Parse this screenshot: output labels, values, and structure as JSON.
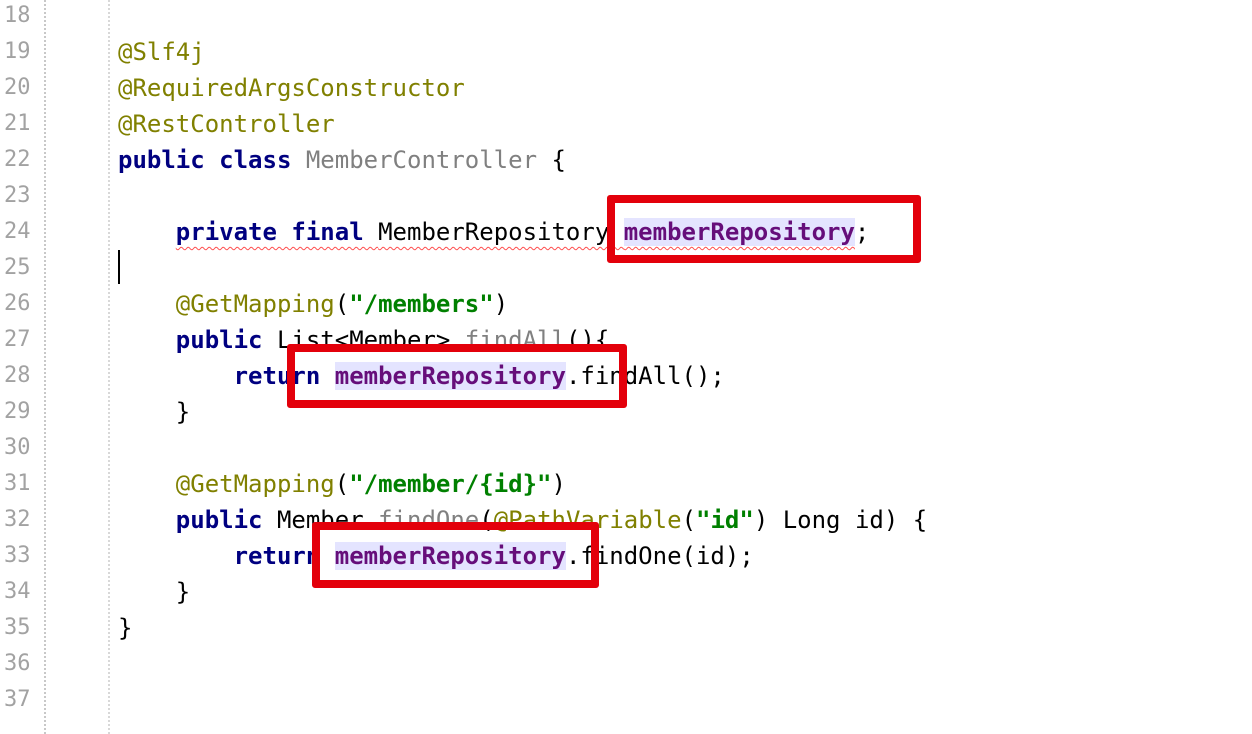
{
  "editor": {
    "lines": [
      {
        "num": "18",
        "segments": []
      },
      {
        "num": "19",
        "segments": [
          {
            "text": "@Slf4j",
            "style": "ann"
          }
        ]
      },
      {
        "num": "20",
        "segments": [
          {
            "text": "@RequiredArgsConstructor",
            "style": "ann"
          }
        ]
      },
      {
        "num": "21",
        "segments": [
          {
            "text": "@RestController",
            "style": "ann"
          }
        ]
      },
      {
        "num": "22",
        "segments": [
          {
            "text": "public class ",
            "style": "kw"
          },
          {
            "text": "MemberController",
            "style": "cls-gray"
          },
          {
            "text": " {",
            "style": ""
          }
        ]
      },
      {
        "num": "23",
        "segments": []
      },
      {
        "num": "24",
        "segments": [
          {
            "text": "    ",
            "style": ""
          },
          {
            "text": "private final ",
            "style": "kw warn"
          },
          {
            "text": "MemberRepository ",
            "style": "warn"
          },
          {
            "text": "memberRepository",
            "style": "fld warn"
          },
          {
            "text": ";",
            "style": ""
          }
        ]
      },
      {
        "num": "25",
        "segments": []
      },
      {
        "num": "26",
        "segments": [
          {
            "text": "    ",
            "style": ""
          },
          {
            "text": "@GetMapping",
            "style": "ann"
          },
          {
            "text": "(",
            "style": ""
          },
          {
            "text": "\"/members\"",
            "style": "str"
          },
          {
            "text": ")",
            "style": ""
          }
        ]
      },
      {
        "num": "27",
        "segments": [
          {
            "text": "    ",
            "style": ""
          },
          {
            "text": "public ",
            "style": "kw"
          },
          {
            "text": "List<Member> ",
            "style": ""
          },
          {
            "text": "findAll",
            "style": "unused"
          },
          {
            "text": "(){",
            "style": ""
          }
        ]
      },
      {
        "num": "28",
        "segments": [
          {
            "text": "        ",
            "style": ""
          },
          {
            "text": "return ",
            "style": "kw"
          },
          {
            "text": "memberRepository",
            "style": "fld"
          },
          {
            "text": ".findAll();",
            "style": ""
          }
        ]
      },
      {
        "num": "29",
        "segments": [
          {
            "text": "    }",
            "style": ""
          }
        ]
      },
      {
        "num": "30",
        "segments": []
      },
      {
        "num": "31",
        "segments": [
          {
            "text": "    ",
            "style": ""
          },
          {
            "text": "@GetMapping",
            "style": "ann"
          },
          {
            "text": "(",
            "style": ""
          },
          {
            "text": "\"/member/{id}\"",
            "style": "str"
          },
          {
            "text": ")",
            "style": ""
          }
        ]
      },
      {
        "num": "32",
        "segments": [
          {
            "text": "    ",
            "style": ""
          },
          {
            "text": "public ",
            "style": "kw"
          },
          {
            "text": "Member ",
            "style": ""
          },
          {
            "text": "findOne",
            "style": "unused"
          },
          {
            "text": "(",
            "style": ""
          },
          {
            "text": "@PathVariable",
            "style": "ann"
          },
          {
            "text": "(",
            "style": ""
          },
          {
            "text": "\"id\"",
            "style": "str"
          },
          {
            "text": ") Long id) {",
            "style": ""
          }
        ]
      },
      {
        "num": "33",
        "segments": [
          {
            "text": "        ",
            "style": ""
          },
          {
            "text": "return ",
            "style": "kw"
          },
          {
            "text": "memberRepository",
            "style": "fld"
          },
          {
            "text": ".findOne(id);",
            "style": ""
          }
        ]
      },
      {
        "num": "34",
        "segments": [
          {
            "text": "    }",
            "style": ""
          }
        ]
      },
      {
        "num": "35",
        "segments": [
          {
            "text": "}",
            "style": ""
          }
        ]
      },
      {
        "num": "36",
        "segments": []
      },
      {
        "num": "37",
        "segments": []
      }
    ]
  },
  "colors": {
    "annotation": "#808000",
    "keyword": "#000080",
    "field": "#660e7a",
    "field_highlight": "#e4e4ff",
    "string": "#008000",
    "line_number": "#a2a2a2",
    "highlight_box": "#e3000b"
  }
}
